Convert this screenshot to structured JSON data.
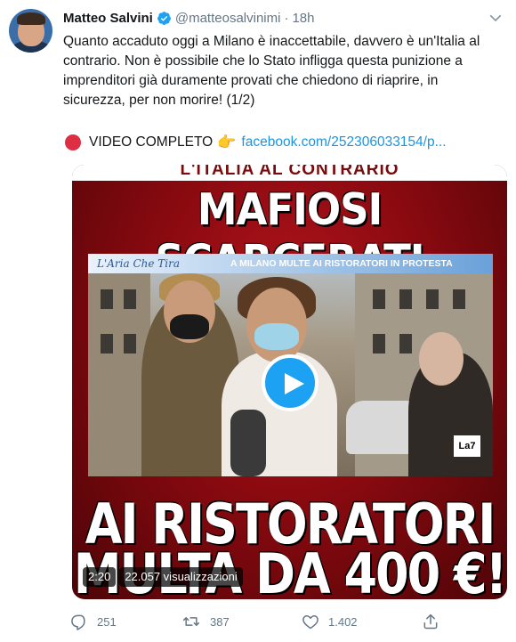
{
  "author": {
    "name": "Matteo Salvini",
    "handle": "@matteosalvinimi",
    "separator": "·",
    "time": "18h",
    "verified": true,
    "avatar_icon": "avatar-photo"
  },
  "tweet": {
    "text": "Quanto accaduto oggi a Milano è inaccettabile, davvero è un'Italia al contrario. Non è possibile che lo Stato infligga questa punizione a imprenditori già duramente provati che chiedono di riaprire, in sicurezza, per non morire! (1/2)",
    "video_label": "VIDEO COMPLETO",
    "link_text": "facebook.com/252306033154/p..."
  },
  "media": {
    "top_band": "L'ITALIA AL CONTRARIO",
    "headline_top": "MAFIOSI SCARCERATI",
    "headline_bottom_1": "AI RISTORATORI",
    "headline_bottom_2": "MULTA DA 400 €!",
    "broadcast_brand": "L'Aria Che Tira",
    "broadcast_ticker": "A MILANO MULTE AI RISTORATORI IN PROTESTA",
    "duration": "2:20",
    "views": "22.057 visualizzazioni"
  },
  "actions": {
    "replies": "251",
    "retweets": "387",
    "likes": "1.402"
  },
  "colors": {
    "link": "#1b95e0",
    "verified": "#1da1f2",
    "muted": "#657786"
  }
}
